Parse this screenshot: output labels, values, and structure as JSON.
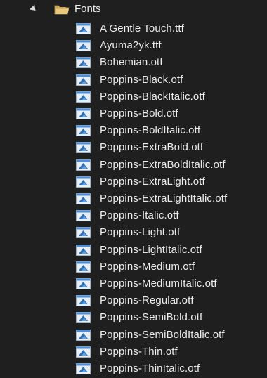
{
  "folder": {
    "label": "Fonts",
    "expanded": true,
    "icon": "folder-open-icon"
  },
  "file_icon": "font-file-icon",
  "colors": {
    "background": "#1f1f1f",
    "text": "#ececec",
    "folder": "#d9b76a",
    "file_icon_blue": "#4a8fd6"
  },
  "files": [
    {
      "label": "A Gentle Touch.ttf"
    },
    {
      "label": "Ayuma2yk.ttf"
    },
    {
      "label": "Bohemian.otf"
    },
    {
      "label": "Poppins-Black.otf"
    },
    {
      "label": "Poppins-BlackItalic.otf"
    },
    {
      "label": "Poppins-Bold.otf"
    },
    {
      "label": "Poppins-BoldItalic.otf"
    },
    {
      "label": "Poppins-ExtraBold.otf"
    },
    {
      "label": "Poppins-ExtraBoldItalic.otf"
    },
    {
      "label": "Poppins-ExtraLight.otf"
    },
    {
      "label": "Poppins-ExtraLightItalic.otf"
    },
    {
      "label": "Poppins-Italic.otf"
    },
    {
      "label": "Poppins-Light.otf"
    },
    {
      "label": "Poppins-LightItalic.otf"
    },
    {
      "label": "Poppins-Medium.otf"
    },
    {
      "label": "Poppins-MediumItalic.otf"
    },
    {
      "label": "Poppins-Regular.otf"
    },
    {
      "label": "Poppins-SemiBold.otf"
    },
    {
      "label": "Poppins-SemiBoldItalic.otf"
    },
    {
      "label": "Poppins-Thin.otf"
    },
    {
      "label": "Poppins-ThinItalic.otf"
    }
  ]
}
